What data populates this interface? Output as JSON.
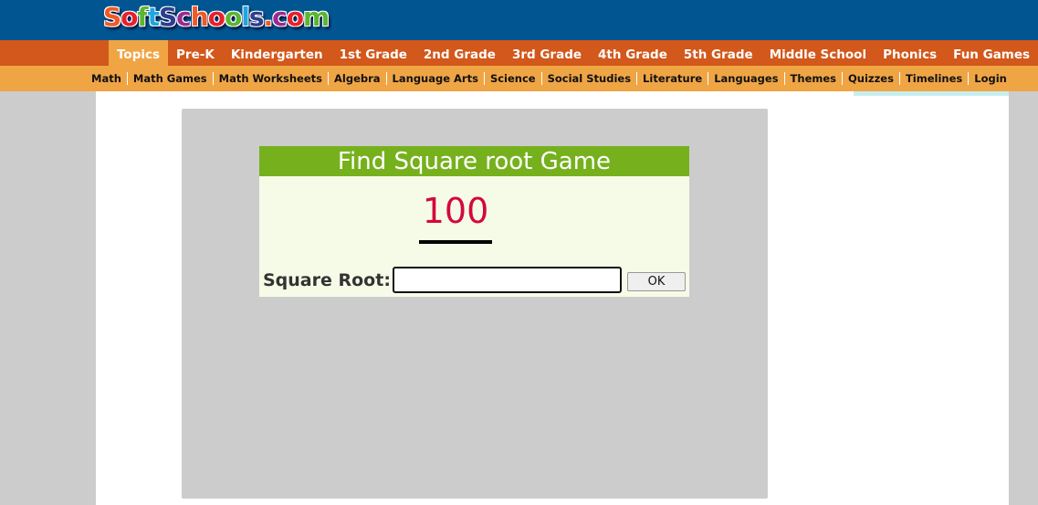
{
  "logo": {
    "text": "SoftSchools.com",
    "letters": [
      "S",
      "o",
      "f",
      "t",
      "S",
      "c",
      "h",
      "o",
      "o",
      "l",
      "s",
      ".",
      "c",
      "o",
      "m"
    ],
    "colors": [
      "#f05a28",
      "#e8202a",
      "#5bb531",
      "#20a6df",
      "#2c3e8f",
      "#9c2a90",
      "#f05a28",
      "#e8202a",
      "#5bb531",
      "#20a6df",
      "#2c3e8f",
      "#f05a28",
      "#9c2a90",
      "#e8202a",
      "#5bb531"
    ]
  },
  "nav_primary": [
    "Topics",
    "Pre-K",
    "Kindergarten",
    "1st Grade",
    "2nd Grade",
    "3rd Grade",
    "4th Grade",
    "5th Grade",
    "Middle School",
    "Phonics",
    "Fun Games"
  ],
  "nav_secondary": [
    "Math",
    "Math Games",
    "Math Worksheets",
    "Algebra",
    "Language Arts",
    "Science",
    "Social Studies",
    "Literature",
    "Languages",
    "Themes",
    "Quizzes",
    "Timelines",
    "Login"
  ],
  "game": {
    "title": "Find Square root Game",
    "number": "100",
    "answer_label": "Square Root:",
    "answer_value": "",
    "ok_label": "OK"
  },
  "colors": {
    "header": "#015591",
    "nav_primary": "#d2581b",
    "nav_secondary": "#f0a545",
    "game_title": "#76b11d",
    "number": "#d3083f"
  }
}
